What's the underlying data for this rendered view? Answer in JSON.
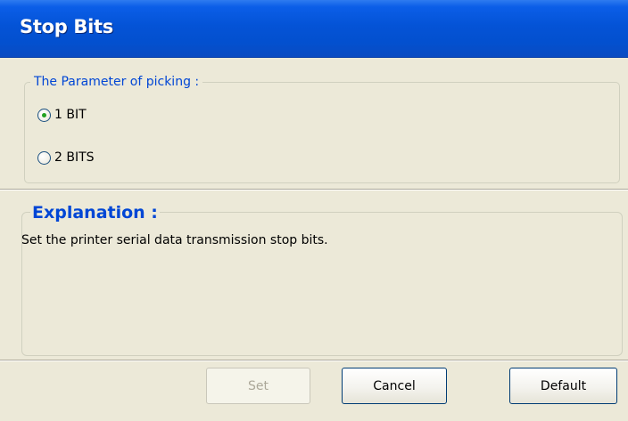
{
  "window": {
    "title": "Stop Bits"
  },
  "parameter_group": {
    "title": "The Parameter of picking :",
    "options": [
      {
        "label": "1 BIT",
        "selected": true
      },
      {
        "label": "2 BITS",
        "selected": false
      }
    ]
  },
  "explanation": {
    "title": "Explanation :",
    "text": "Set the printer serial data transmission stop bits."
  },
  "buttons": {
    "set_label": "Set",
    "set_enabled": false,
    "cancel_label": "Cancel",
    "default_label": "Default"
  },
  "colors": {
    "title_bar": "#0453d6",
    "group_title": "#0046d5",
    "radio_selected_dot": "#21a121",
    "dialog_background": "#ece9d8"
  }
}
